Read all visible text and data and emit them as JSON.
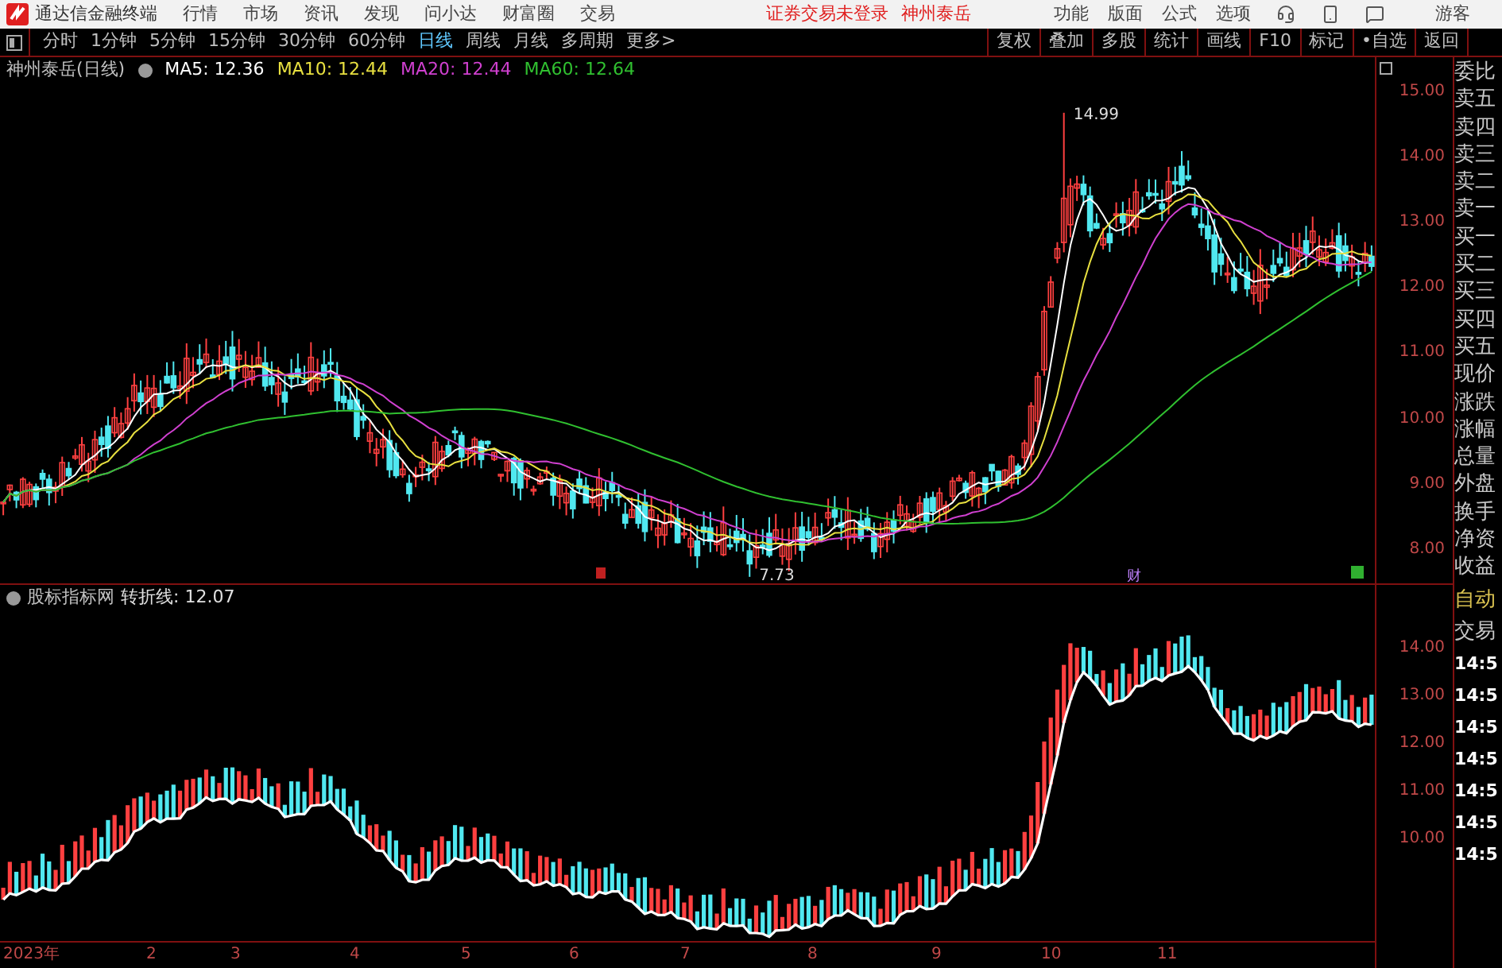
{
  "app": {
    "title": "通达信金融终端",
    "menu": [
      "行情",
      "市场",
      "资讯",
      "发现",
      "问小达",
      "财富圈",
      "交易"
    ],
    "login_status": "证券交易未登录",
    "stock": "神州泰岳",
    "right_menu": [
      "功能",
      "版面",
      "公式",
      "选项"
    ],
    "user": "游客"
  },
  "period_tabs": [
    {
      "label": "分时",
      "selected": false
    },
    {
      "label": "1分钟",
      "selected": false
    },
    {
      "label": "5分钟",
      "selected": false
    },
    {
      "label": "15分钟",
      "selected": false
    },
    {
      "label": "30分钟",
      "selected": false
    },
    {
      "label": "60分钟",
      "selected": false
    },
    {
      "label": "日线",
      "selected": true
    },
    {
      "label": "周线",
      "selected": false
    },
    {
      "label": "月线",
      "selected": false
    },
    {
      "label": "多周期",
      "selected": false
    },
    {
      "label": "更多>",
      "selected": false
    }
  ],
  "tools": [
    "复权",
    "叠加",
    "多股",
    "统计",
    "画线",
    "F10",
    "标记",
    "•自选",
    "返回"
  ],
  "main_chart": {
    "title": "神州泰岳(日线)",
    "ma": [
      {
        "label": "MA5: 12.36",
        "color": "#ffffff"
      },
      {
        "label": "MA10: 12.44",
        "color": "#e8e040"
      },
      {
        "label": "MA20: 12.44",
        "color": "#d040d0"
      },
      {
        "label": "MA60: 12.64",
        "color": "#30c030"
      }
    ],
    "high_label": "14.99",
    "low_label": "7.73",
    "marker": "财",
    "y_labels": [
      "15.00",
      "14.00",
      "13.00",
      "12.00",
      "11.00",
      "10.00",
      "9.00",
      "8.00"
    ]
  },
  "indicator": {
    "title": "股标指标网",
    "reading": "转折线: 12.07",
    "y_labels": [
      "14.00",
      "13.00",
      "12.00",
      "11.00",
      "10.00"
    ]
  },
  "dates": [
    "2023年",
    "2",
    "3",
    "4",
    "5",
    "6",
    "7",
    "8",
    "9",
    "10",
    "11"
  ],
  "side_upper": [
    "委比",
    "卖五",
    "卖四",
    "卖三",
    "卖二",
    "卖一",
    "买一",
    "买二",
    "买三",
    "买四",
    "买五",
    "现价",
    "涨跌",
    "涨幅",
    "总量",
    "外盘",
    "换手",
    "净资",
    "收益"
  ],
  "side_lower": [
    {
      "label": "自动",
      "kind": "mode"
    },
    {
      "label": "交易",
      "kind": "label"
    },
    {
      "label": "14:5",
      "kind": "time"
    },
    {
      "label": "14:5",
      "kind": "time"
    },
    {
      "label": "14:5",
      "kind": "time"
    },
    {
      "label": "14:5",
      "kind": "time"
    },
    {
      "label": "14:5",
      "kind": "time"
    },
    {
      "label": "14:5",
      "kind": "time"
    },
    {
      "label": "14:5",
      "kind": "time"
    }
  ]
}
